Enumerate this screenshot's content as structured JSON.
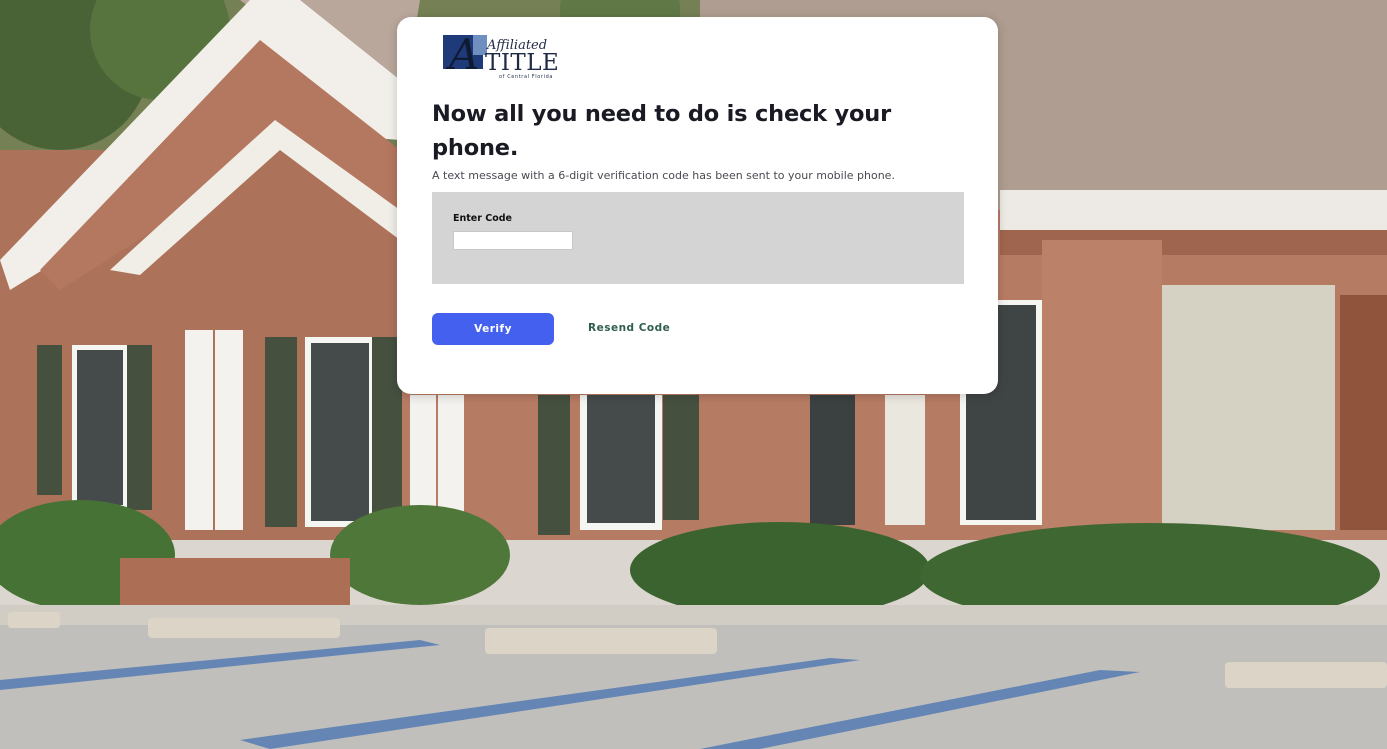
{
  "logo": {
    "script_text": "Affiliated",
    "main_text": "TITLE",
    "sub_text": "of Central Florida",
    "letter": "A"
  },
  "verification": {
    "headline": "Now all you need to do is check your phone.",
    "description": "A text message with a 6-digit verification code has been sent to your mobile phone.",
    "code_label": "Enter Code",
    "code_value": "",
    "code_placeholder": ""
  },
  "actions": {
    "verify_label": "Verify",
    "resend_label": "Resend Code"
  },
  "colors": {
    "primary_button": "#4361ee",
    "resend_link": "#2f5d50",
    "panel_bg": "#d4d4d4"
  }
}
